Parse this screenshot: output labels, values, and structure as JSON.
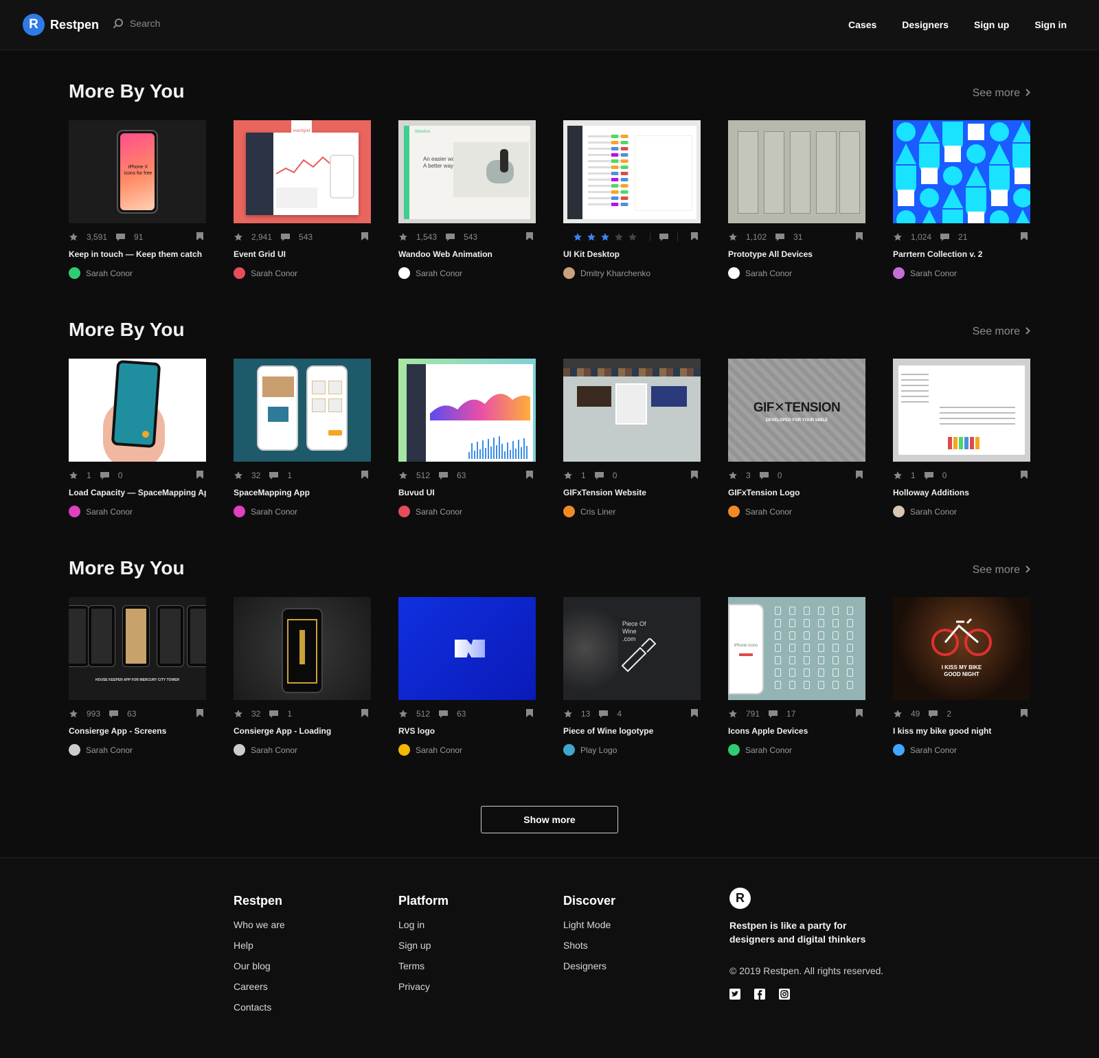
{
  "header": {
    "brand": "Restpen",
    "search_placeholder": "Search",
    "nav": [
      "Cases",
      "Designers",
      "Sign up",
      "Sign in"
    ]
  },
  "sections": [
    {
      "title": "More By You",
      "see_more": "See more",
      "cards": [
        {
          "likes": "3,591",
          "comments": "91",
          "title": "Keep in touch — Keep them catch",
          "author": "Sarah Conor",
          "thumb": "iphone-dark",
          "avatar_color": "#2ecc71"
        },
        {
          "likes": "2,941",
          "comments": "543",
          "title": "Event Grid UI",
          "author": "Sarah Conor",
          "thumb": "eventgrid",
          "avatar_color": "#e74c5c"
        },
        {
          "likes": "1,543",
          "comments": "543",
          "title": "Wandoo Web Animation",
          "author": "Sarah Conor",
          "thumb": "wandoo",
          "avatar_color": "#ffffff"
        },
        {
          "likes": "",
          "comments": "",
          "title": "UI Kit Desktop",
          "author": "Dmitry Kharchenko",
          "thumb": "uikit",
          "avatar_color": "#c9a27e",
          "rating": 3
        },
        {
          "likes": "1,102",
          "comments": "31",
          "title": "Prototype All Devices",
          "author": "Sarah Conor",
          "thumb": "prototype",
          "avatar_color": "#ffffff"
        },
        {
          "likes": "1,024",
          "comments": "21",
          "title": "Parrtern Collection v. 2",
          "author": "Sarah Conor",
          "thumb": "pattern",
          "avatar_color": "#c86dd7"
        }
      ]
    },
    {
      "title": "More By You",
      "see_more": "See more",
      "cards": [
        {
          "likes": "1",
          "comments": "0",
          "title": "Load Capacity — SpaceMapping App",
          "author": "Sarah Conor",
          "thumb": "loadcap",
          "avatar_color": "#e040c0"
        },
        {
          "likes": "32",
          "comments": "1",
          "title": "SpaceMapping App",
          "author": "Sarah Conor",
          "thumb": "spacemap",
          "avatar_color": "#e040c0"
        },
        {
          "likes": "512",
          "comments": "63",
          "title": "Buvud UI",
          "author": "Sarah Conor",
          "thumb": "buvud",
          "avatar_color": "#e74c5c"
        },
        {
          "likes": "1",
          "comments": "0",
          "title": "GIFxTension Website",
          "author": "Cris Liner",
          "thumb": "gifweb",
          "avatar_color": "#f08a24"
        },
        {
          "likes": "3",
          "comments": "0",
          "title": "GIFxTension Logo",
          "author": "Sarah Conor",
          "thumb": "giflogo",
          "avatar_color": "#f08a24"
        },
        {
          "likes": "1",
          "comments": "0",
          "title": "Holloway Additions",
          "author": "Sarah Conor",
          "thumb": "holloway",
          "avatar_color": "#d9c7b3"
        }
      ]
    },
    {
      "title": "More By You",
      "see_more": "See more",
      "cards": [
        {
          "likes": "993",
          "comments": "63",
          "title": "Consierge App - Screens",
          "author": "Sarah Conor",
          "thumb": "concierge",
          "avatar_color": "#cccccc"
        },
        {
          "likes": "32",
          "comments": "1",
          "title": "Consierge App - Loading",
          "author": "Sarah Conor",
          "thumb": "concierge2",
          "avatar_color": "#cccccc"
        },
        {
          "likes": "512",
          "comments": "63",
          "title": "RVS logo",
          "author": "Sarah Conor",
          "thumb": "rvs",
          "avatar_color": "#f5b800"
        },
        {
          "likes": "13",
          "comments": "4",
          "title": "Piece of Wine logotype",
          "author": "Play Logo",
          "thumb": "wine",
          "avatar_color": "#3fa7c9"
        },
        {
          "likes": "791",
          "comments": "17",
          "title": "Icons Apple Devices",
          "author": "Sarah Conor",
          "thumb": "icons",
          "avatar_color": "#2ecc71"
        },
        {
          "likes": "49",
          "comments": "2",
          "title": "I kiss my bike good night",
          "author": "Sarah Conor",
          "thumb": "bike",
          "avatar_color": "#3fa7ff"
        }
      ]
    }
  ],
  "thumb_text": {
    "iphone": "iPhone X icons for free",
    "eventgrid": "eventgrid",
    "wandoo_brand": "Wandoo",
    "wandoo": "An easier way to borrow. A better way to lend.",
    "gif_logo": "GIF✕TENSION",
    "gif_sub": "DEVELOPED FOR YOUR SMILE",
    "concierge": "HOUSE KEEPER APP FOR MERCURY CITY TOWER",
    "wine": "Piece Of Wine .com",
    "icons_phone": "iPhone icons",
    "bike": "I KISS MY BIKE GOOD NIGHT"
  },
  "show_more": "Show more",
  "footer": {
    "columns": [
      {
        "title": "Restpen",
        "links": [
          "Who we are",
          "Help",
          "Our blog",
          "Careers",
          "Contacts"
        ]
      },
      {
        "title": "Platform",
        "links": [
          "Log in",
          "Sign up",
          "Terms",
          "Privacy"
        ]
      },
      {
        "title": "Discover",
        "links": [
          "Light Mode",
          "Shots",
          "Designers"
        ]
      }
    ],
    "tagline": "Restpen is like a party for designers and digital thinkers",
    "copyright": "© 2019 Restpen. All rights reserved.",
    "social": [
      "twitter-icon",
      "facebook-icon",
      "instagram-icon"
    ]
  },
  "colors": {
    "background": "#0d0d0d",
    "accent": "#2f7be6",
    "rating_star": "#3b82f6"
  }
}
